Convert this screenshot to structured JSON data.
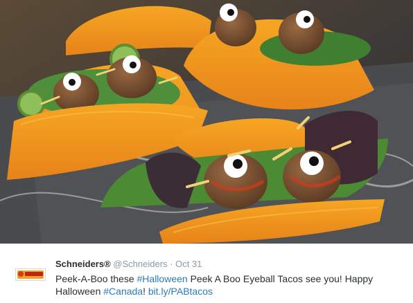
{
  "tweet": {
    "display_name": "Schneiders®",
    "handle": "@Schneiders",
    "separator": "·",
    "date": "Oct 31",
    "text_part1": "Peek-A-Boo these ",
    "hashtag1": "#Halloween",
    "text_part2": " Peek A Boo Eyeball Tacos see you! Happy Halloween ",
    "hashtag2": "#Canada",
    "text_part3": "!  ",
    "link": "bit.ly/PABtacos"
  },
  "icons": {
    "avatar": "schneiders-logo-icon"
  },
  "colors": {
    "text": "#292f33",
    "meta": "#8899a6",
    "link": "#2b7bb9",
    "taco_shell": "#f39a1d"
  }
}
